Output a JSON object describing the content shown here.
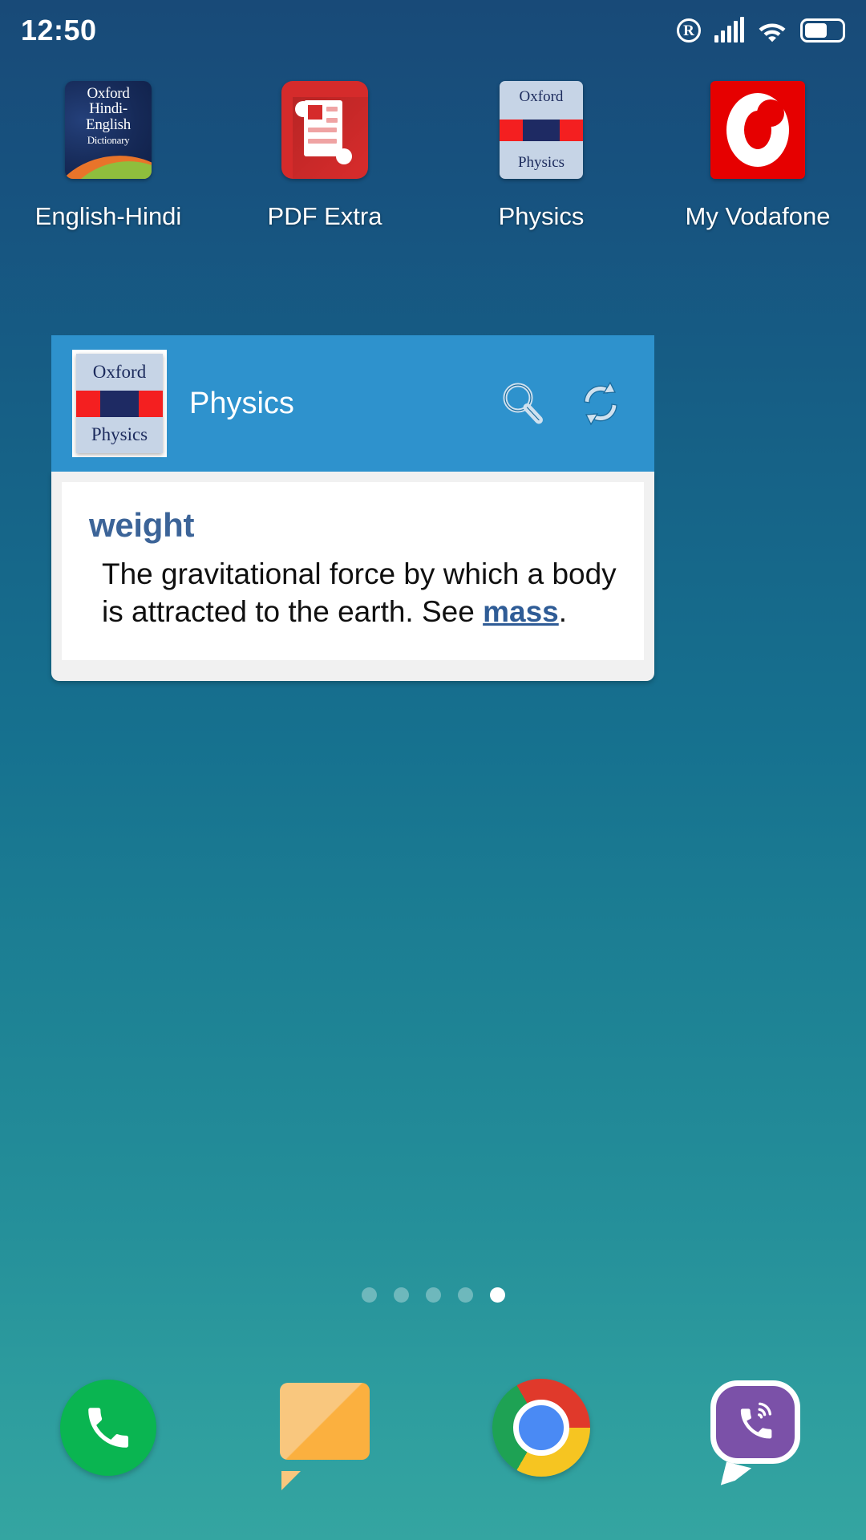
{
  "status_bar": {
    "time": "12:50",
    "icons": [
      {
        "name": "roaming-icon",
        "glyph": "R"
      },
      {
        "name": "signal-icon",
        "bars": 5
      },
      {
        "name": "wifi-icon"
      },
      {
        "name": "battery-icon",
        "level_pct": 62
      }
    ]
  },
  "home_screen": {
    "apps": [
      {
        "name": "english-hindi",
        "label": "English-Hindi",
        "icon": "oxford-hindi-english-dictionary-icon",
        "icon_text": {
          "l1": "Oxford",
          "l2": "Hindi-",
          "l3": "English",
          "l4": "Dictionary"
        }
      },
      {
        "name": "pdf-extra",
        "label": "PDF Extra",
        "icon": "pdf-extra-icon"
      },
      {
        "name": "physics",
        "label": "Physics",
        "icon": "oxford-physics-icon",
        "icon_text": {
          "top": "Oxford",
          "bottom": "Physics"
        }
      },
      {
        "name": "my-vodafone",
        "label": "My Vodafone",
        "icon": "vodafone-icon"
      }
    ],
    "page_indicator": {
      "total": 5,
      "active_index": 5
    }
  },
  "widget": {
    "title": "Physics",
    "icon_text": {
      "top": "Oxford",
      "bottom": "Physics"
    },
    "actions": [
      {
        "name": "search-icon",
        "label": "Search"
      },
      {
        "name": "refresh-icon",
        "label": "Refresh"
      }
    ],
    "entry": {
      "headword": "weight",
      "definition_before": "The gravitational force by which a body is attracted to the earth. See ",
      "cross_reference": "mass",
      "definition_after": "."
    }
  },
  "dock": {
    "items": [
      {
        "name": "phone-app",
        "label": "Phone",
        "icon": "phone-icon"
      },
      {
        "name": "messages-app",
        "label": "Messages",
        "icon": "message-bubble-icon"
      },
      {
        "name": "chrome-app",
        "label": "Chrome",
        "icon": "chrome-icon"
      },
      {
        "name": "viber-app",
        "label": "Viber",
        "icon": "viber-icon"
      }
    ]
  },
  "colors": {
    "wallpaper_top": "#184a78",
    "wallpaper_bottom": "#34a5a1",
    "widget_header": "#2e92cd",
    "headword": "#3c6498",
    "cross_reference": "#2f5c96",
    "vodafone_red": "#e60000",
    "pdf_red": "#d52b2b",
    "phone_green": "#0ab551",
    "viber_purple": "#7b51a8"
  }
}
